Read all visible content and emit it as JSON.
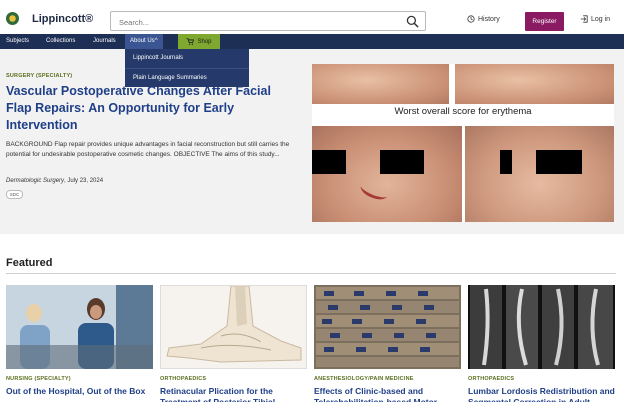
{
  "header": {
    "brand": "Lippincott®",
    "search_placeholder": "Search...",
    "history_label": "History",
    "register_label": "Register",
    "login_label": "Log in"
  },
  "nav": {
    "items": [
      "Subjects",
      "Collections",
      "Journals",
      "About Us"
    ],
    "shop_label": "Shop"
  },
  "dropdown": {
    "items": [
      "Lippincott Journals",
      "Plain Language Summaries"
    ]
  },
  "hero": {
    "category": "SURGERY (SPECIALTY)",
    "title": "Vascular Postoperative Changes After Facial Flap Repairs: An Opportunity for Early Intervention",
    "abstract": "BACKGROUND Flap repair provides unique advantages in facial reconstruction but still carries the potential for undesirable postoperative cosmetic changes. OBJECTIVE The aims of this study...",
    "journal": "Dermatologic Surgery",
    "date": ", July 23, 2024",
    "badge": "SDC",
    "figure_caption": "Worst overall score for erythema"
  },
  "featured": {
    "heading": "Featured",
    "cards": [
      {
        "category": "NURSING (SPECIALTY)",
        "title": "Out of the Hospital, Out of the Box"
      },
      {
        "category": "ORTHOPAEDICS",
        "title": "Retinacular Plication for the Treatment of Posterior Tibial"
      },
      {
        "category": "ANESTHESIOLOGY/PAIN MEDICINE",
        "title": "Effects of Clinic-based and Telerehabilitation-based Motor"
      },
      {
        "category": "ORTHOPAEDICS",
        "title": "Lumbar Lordosis Redistribution and Segmental Correction in Adult"
      }
    ]
  },
  "colors": {
    "nav_bg": "#1e2f55",
    "register_bg": "#8a1a62",
    "shop_bg": "#7ea830",
    "title_blue": "#1f3f88",
    "category_green": "#5b6e1f"
  }
}
